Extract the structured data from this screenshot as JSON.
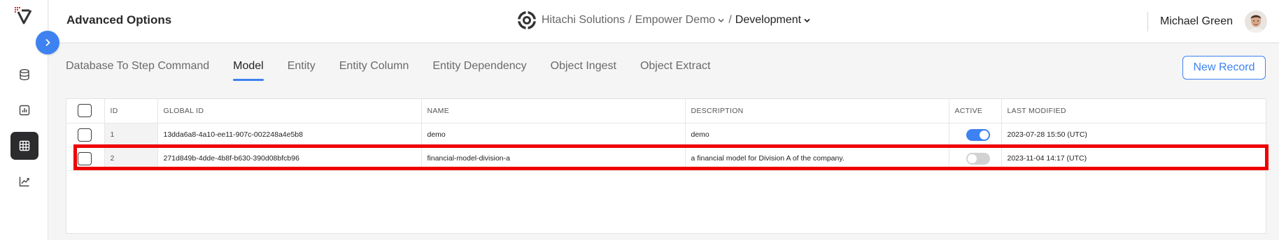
{
  "header": {
    "title": "Advanced Options",
    "org": "Hitachi Solutions",
    "separator1": "/",
    "project": "Empower Demo",
    "separator2": "/",
    "environment": "Development",
    "user_name": "Michael Green"
  },
  "sidebar": {
    "items": [
      {
        "icon": "database-icon"
      },
      {
        "icon": "bar-chart-icon"
      },
      {
        "icon": "table-grid-icon",
        "active": true
      },
      {
        "icon": "line-chart-icon"
      }
    ]
  },
  "tabs": [
    {
      "label": "Database To Step Command"
    },
    {
      "label": "Model",
      "active": true
    },
    {
      "label": "Entity"
    },
    {
      "label": "Entity Column"
    },
    {
      "label": "Entity Dependency"
    },
    {
      "label": "Object Ingest"
    },
    {
      "label": "Object Extract"
    }
  ],
  "actions": {
    "new_record_label": "New Record"
  },
  "table": {
    "columns": [
      "ID",
      "GLOBAL ID",
      "NAME",
      "DESCRIPTION",
      "ACTIVE",
      "LAST MODIFIED"
    ],
    "rows": [
      {
        "id": "1",
        "global_id": "13dda6a8-4a10-ee11-907c-002248a4e5b8",
        "name": "demo",
        "description": "demo",
        "active": true,
        "last_modified": "2023-07-28 15:50 (UTC)"
      },
      {
        "id": "2",
        "global_id": "271d849b-4dde-4b8f-b630-390d08bfcb96",
        "name": "financial-model-division-a",
        "description": "a financial model for Division A of the company.",
        "active": false,
        "last_modified": "2023-11-04 14:17 (UTC)"
      }
    ]
  },
  "colors": {
    "accent": "#3d82f0",
    "highlight": "#ee0000",
    "sidebar_active": "#2c2c2e"
  }
}
